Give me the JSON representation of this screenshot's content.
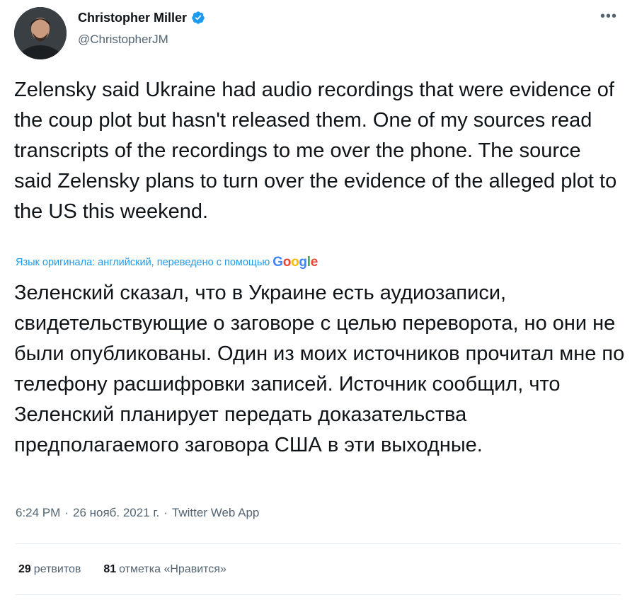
{
  "author": {
    "name": "Christopher Miller",
    "handle": "@ChristopherJM",
    "verified": true
  },
  "more_icon": "more-horizontal-icon",
  "tweet": {
    "text_en": "Zelensky said Ukraine had audio recordings that were evidence of the coup plot but hasn't released them. One of my sources read transcripts of the recordings to me over the phone. The source said Zelensky plans to turn over the evidence of the alleged plot to the US this weekend.",
    "translation_note": "Язык оригинала: английский, переведено с помощью",
    "translation_provider": "Google",
    "text_ru": "Зеленский сказал, что в Украине есть аудиозаписи, свидетельствующие о заговоре с целью переворота, но они не были опубликованы. Один из моих источников прочитал мне по телефону расшифровки записей. Источник сообщил, что Зеленский планирует передать доказательства предполагаемого заговора США в эти выходные."
  },
  "meta": {
    "time": "6:24 PM",
    "separator": "·",
    "date": "26 нояб. 2021 г.",
    "source": "Twitter Web App"
  },
  "stats": {
    "retweets_count": "29",
    "retweets_label": "ретвитов",
    "likes_count": "81",
    "likes_label": "отметка «Нравится»"
  },
  "colors": {
    "link_blue": "#1d9bf0",
    "text_primary": "#0f1419",
    "text_secondary": "#536471"
  }
}
